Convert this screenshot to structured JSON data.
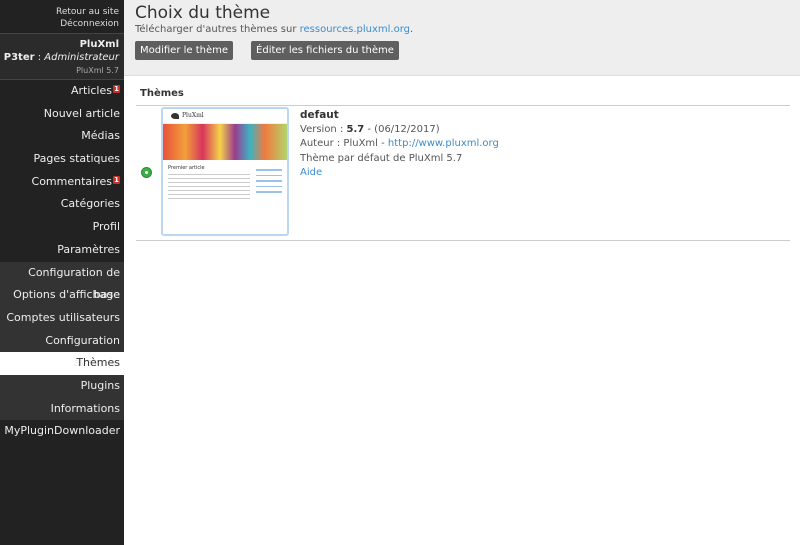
{
  "sidebar": {
    "back_to_site": "Retour au site",
    "logout": "Déconnexion",
    "site_name": "PluXml",
    "user_name": "P3ter",
    "user_sep": " : ",
    "user_role": "Administrateur",
    "version": "PluXml 5.7",
    "menu": [
      {
        "label": "Articles",
        "badge": "1",
        "type": "main"
      },
      {
        "label": "Nouvel article",
        "badge": "",
        "type": "main"
      },
      {
        "label": "Médias",
        "badge": "",
        "type": "main"
      },
      {
        "label": "Pages statiques",
        "badge": "",
        "type": "main"
      },
      {
        "label": "Commentaires",
        "badge": "1",
        "type": "main"
      },
      {
        "label": "Catégories",
        "badge": "",
        "type": "main"
      },
      {
        "label": "Profil",
        "badge": "",
        "type": "main"
      },
      {
        "label": "Paramètres",
        "badge": "",
        "type": "main"
      },
      {
        "label": "Configuration de base",
        "badge": "",
        "type": "sub"
      },
      {
        "label": "Options d'affichage",
        "badge": "",
        "type": "sub"
      },
      {
        "label": "Comptes utilisateurs",
        "badge": "",
        "type": "sub"
      },
      {
        "label": "Configuration avancée",
        "badge": "",
        "type": "sub"
      },
      {
        "label": "Thèmes",
        "badge": "",
        "type": "active"
      },
      {
        "label": "Plugins",
        "badge": "",
        "type": "sub"
      },
      {
        "label": "Informations",
        "badge": "",
        "type": "sub"
      },
      {
        "label": "MyPluginDownloader",
        "badge": "",
        "type": "main"
      }
    ]
  },
  "header": {
    "title": "Choix du thème",
    "subtitle_prefix": "Télécharger d'autres thèmes sur ",
    "subtitle_link": "ressources.pluxml.org",
    "subtitle_suffix": ".",
    "btn_modify": "Modifier le thème",
    "btn_edit_files": "Éditer les fichiers du thème"
  },
  "themes": {
    "section_title": "Thèmes",
    "thumb_name": "PluXml",
    "thumb_article": "Premier article",
    "item": {
      "name": "defaut",
      "version_label": "Version : ",
      "version": "5.7",
      "date": " - (06/12/2017)",
      "author_label": "Auteur : PluXml - ",
      "author_link": "http://www.pluxml.org",
      "description": "Thème par défaut de PluXml 5.7",
      "help": "Aide",
      "selected": true
    }
  },
  "colors": {
    "sidebar_bg": "#222222",
    "link": "#3b8ccf",
    "badge": "#c9302c",
    "radio_selected": "#3fae49"
  }
}
